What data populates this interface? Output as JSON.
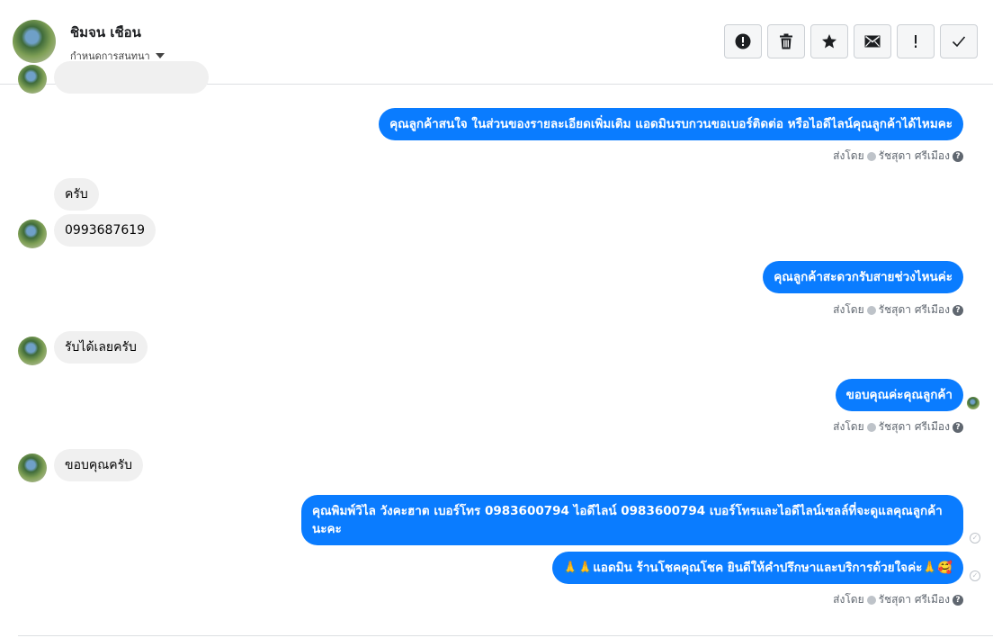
{
  "header": {
    "contact_name": "ชิมจน เชือน",
    "assign_label": "กำหนดการสนทนา",
    "toolbar": [
      {
        "name": "spam-button",
        "icon": "alert-circle-icon"
      },
      {
        "name": "delete-button",
        "icon": "trash-icon"
      },
      {
        "name": "star-button",
        "icon": "star-icon"
      },
      {
        "name": "mark-unread-button",
        "icon": "envelope-icon"
      },
      {
        "name": "follow-up-button",
        "icon": "exclamation-icon"
      },
      {
        "name": "mark-done-button",
        "icon": "checkmark-icon"
      }
    ]
  },
  "messages": {
    "out1": "คุณลูกค้าสนใจ ในส่วนของรายละเอียดเพิ่มเติม แอดมินรบกวนขอเบอร์ติดต่อ หรือไอดีไลน์คุณลูกค้าได้ไหมคะ",
    "in1": "ครับ",
    "in2": "0993687619",
    "out2": "คุณลูกค้าสะดวกรับสายช่วงไหนค่ะ",
    "in3": "รับได้เลยครับ",
    "out3": "ขอบคุณค่ะคุณลูกค้า",
    "in4": "ขอบคุณครับ",
    "out4": "คุณพิมพ์วิไล วังคะฮาต   เบอร์โทร 0983600794  ไอดีไลน์ 0983600794   เบอร์โทรและไอดีไลน์เซลล์ที่จะดูแลคุณลูกค้านะคะ",
    "out5": "🙏🙏แอดมิน ร้านโชคคุณโชค ยินดีให้คำปรึกษาและบริการด้วยใจค่ะ🙏🥰"
  },
  "sent_meta": {
    "prefix": "ส่งโดย",
    "sender": "รัชสุดา ศรีเมือง"
  },
  "colors": {
    "outgoing_bubble": "#0a7cff",
    "incoming_bubble": "#f0f0f0"
  }
}
